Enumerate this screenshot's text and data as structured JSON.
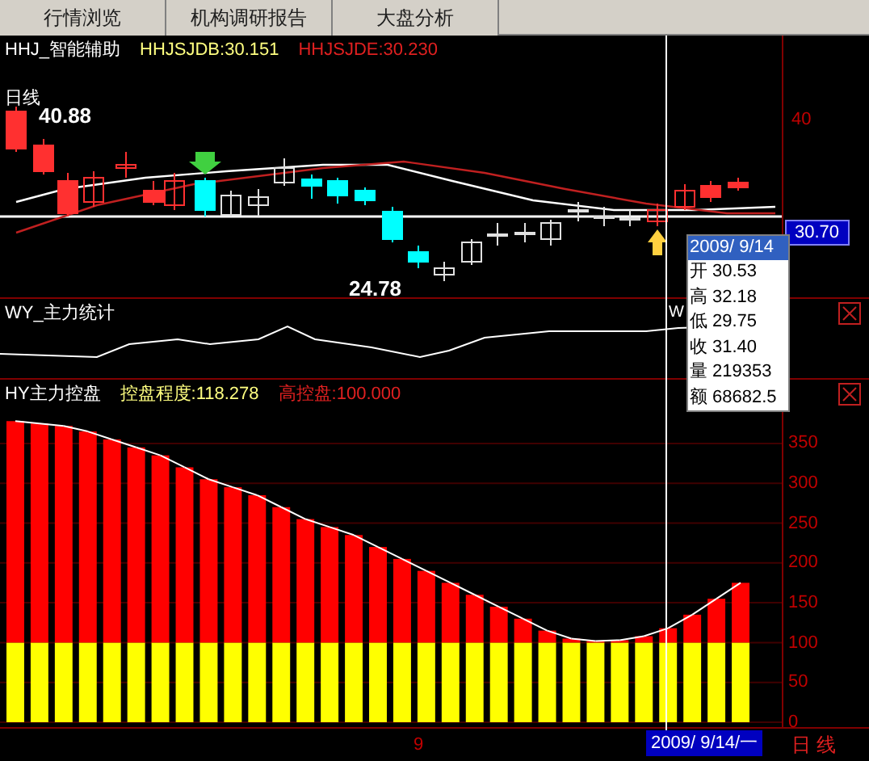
{
  "tabs": [
    {
      "label": "行情浏览",
      "selected": false
    },
    {
      "label": "机构调研报告",
      "selected": false
    },
    {
      "label": "大盘分析",
      "selected": false
    }
  ],
  "price_panel": {
    "title": "HHJ_智能辅助",
    "indicators": [
      {
        "text": "HHJSJDB:30.151",
        "color": "#ffff80"
      },
      {
        "text": "HHJSJDE:30.230",
        "color": "#e02020"
      }
    ],
    "period": "日线",
    "high_label": "40.88",
    "low_label": "24.78",
    "axis_label": "40",
    "current_price": "30.70"
  },
  "info_popup": {
    "date": "2009/ 9/14",
    "rows": [
      {
        "label": "开",
        "value": "30.53"
      },
      {
        "label": "高",
        "value": "32.18"
      },
      {
        "label": "低",
        "value": "29.75"
      },
      {
        "label": "收",
        "value": "31.40"
      },
      {
        "label": "量",
        "value": "219353"
      },
      {
        "label": "额",
        "value": "68682.5"
      }
    ]
  },
  "stats_panel": {
    "title": "WY_主力统计",
    "cursor_text": "W"
  },
  "control_panel": {
    "title": "HY主力控盘",
    "legend": [
      {
        "value": ":118.278",
        "color": "#ffff80"
      },
      {
        "value": ":100.000",
        "color": "#e02020"
      }
    ],
    "chart_data": {
      "type": "bar",
      "ylim": [
        0,
        430
      ],
      "yticks": [
        0,
        50,
        100,
        150,
        200,
        250,
        300,
        350
      ],
      "stacked": true,
      "grid": true,
      "series": [
        {
          "name": "高控盘",
          "color": "#ffff00",
          "values": [
            100,
            100,
            100,
            100,
            100,
            100,
            100,
            100,
            100,
            100,
            100,
            100,
            100,
            100,
            100,
            100,
            100,
            100,
            100,
            100,
            100,
            100,
            100,
            100,
            100,
            100,
            100,
            100,
            100,
            100,
            100
          ]
        },
        {
          "name": "控盘程度",
          "color": "#ff0000",
          "values": [
            278,
            275,
            272,
            265,
            255,
            245,
            235,
            220,
            205,
            195,
            185,
            170,
            155,
            145,
            135,
            120,
            105,
            90,
            75,
            60,
            45,
            30,
            15,
            5,
            2,
            3,
            8,
            18,
            35,
            55,
            75
          ]
        }
      ]
    }
  },
  "time_axis": {
    "month_label": "9",
    "cursor_date": "2009/ 9/14/一",
    "period": "日 线"
  }
}
